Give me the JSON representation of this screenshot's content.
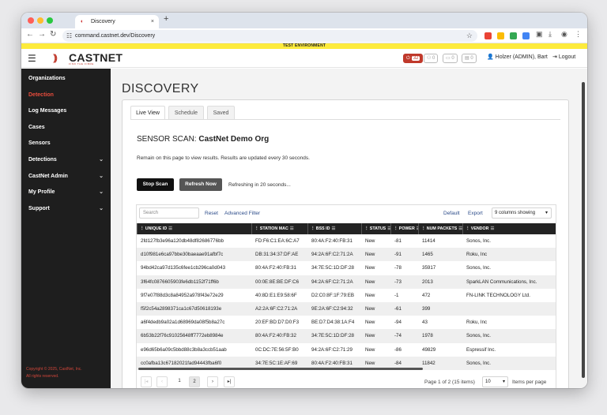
{
  "browser": {
    "tab_title": "Discovery",
    "tab_close": "×",
    "new_tab": "+",
    "url": "command.castnet.dev/Discovery",
    "lights": [
      "#ff5f57",
      "#febc2e",
      "#28c840"
    ],
    "ext_colors": [
      "#ea4335",
      "#fbbc05",
      "#34a853",
      "#4285f4"
    ]
  },
  "banner": "TEST ENVIRONMENT",
  "header": {
    "logo_text": "CASTNET",
    "logo_tagline": "FIND THE FIBRE",
    "alert_count": "32",
    "badges": [
      "0",
      "0",
      "0",
      "0"
    ],
    "user": "Holzer (ADMIN), Bart",
    "logout": "Logout",
    "accent": "#c0392b"
  },
  "sidebar": {
    "items": [
      {
        "label": "Organizations",
        "chev": ""
      },
      {
        "label": "Detection",
        "chev": ""
      },
      {
        "label": "Log Messages",
        "chev": ""
      },
      {
        "label": "Cases",
        "chev": ""
      },
      {
        "label": "Sensors",
        "chev": ""
      },
      {
        "label": "Detections",
        "chev": "⌄"
      },
      {
        "label": "CastNet Admin",
        "chev": "⌄"
      },
      {
        "label": "My Profile",
        "chev": "⌄"
      },
      {
        "label": "Support",
        "chev": "⌄"
      }
    ],
    "footer_line1": "Copyright © 2025, CastNet, Inc.",
    "footer_line2": "All rights reserved."
  },
  "page": {
    "title": "DISCOVERY",
    "tabs": [
      "Live View",
      "Schedule",
      "Saved"
    ],
    "scan_prefix": "SENSOR SCAN: ",
    "scan_org": "CastNet Demo Org",
    "note": "Remain on this page to view results. Results are updated every 30 seconds.",
    "stop_scan": "Stop Scan",
    "refresh_now": "Refresh Now",
    "refresh_status": "Refreshing in 20 seconds..."
  },
  "grid": {
    "search_placeholder": "Search",
    "reset": "Reset",
    "advanced_filter": "Advanced Filter",
    "default": "Default",
    "export": "Export",
    "columns_showing": "9 columns showing",
    "headers": [
      "UNIQUE ID",
      "STATION MAC",
      "BSS ID",
      "STATUS",
      "POWER",
      "NUM PACKETS",
      "VENDOR"
    ],
    "rows": [
      [
        "2fd127fb3e96a120db48df82686776bb",
        "FD:F6:C1:EA:6C:A7",
        "80:4A:F2:40:FB:31",
        "New",
        "-81",
        "11414",
        "Sonos, Inc."
      ],
      [
        "d10f981e6ca97bbe30baeaae91afbf7c",
        "DB:31:34:37:DF:AE",
        "94:2A:6F:C2:71:2A",
        "New",
        "-91",
        "1465",
        "Roku, Inc"
      ],
      [
        "94bd42ca97d135c6fee1cb296ca0d043",
        "80:4A:F2:40:FB:31",
        "34:7E:5C:1D:DF:28",
        "New",
        "-78",
        "35917",
        "Sonos, Inc."
      ],
      [
        "3f64fc0876605903fe6db1152f71ff6b",
        "00:0E:8E:BE:DF:C6",
        "94:2A:6F:C2:71:2A",
        "New",
        "-73",
        "2013",
        "SparkLAN Communications, Inc."
      ],
      [
        "9f7e07f88d3c8a84952a978f43e72e29",
        "40:8D:E1:E9:58:6F",
        "D2:C0:8F:1F:79:EB",
        "New",
        "-1",
        "472",
        "FN-LINK TECHNOLOGY Ltd."
      ],
      [
        "f5f2c54a2898371ca1c67d50618193e",
        "A2:2A:6F:C2:71:2A",
        "9E:2A:6F:C2:94:32",
        "New",
        "-61",
        "399",
        ""
      ],
      [
        "a6f4dedb9a02a1d68969da08f5b8a27c",
        "20:EF:BD:D7:D0:F3",
        "BE:D7:D4:38:1A:F4",
        "New",
        "-94",
        "43",
        "Roku, Inc"
      ],
      [
        "6b53b22f76c91025648ff7772eb8984e",
        "80:4A:F2:40:FB:32",
        "34:7E:5C:1D:DF:28",
        "New",
        "-74",
        "1978",
        "Sonos, Inc."
      ],
      [
        "e96d65b6a09c5bbd88c3b8a3ccb51aab",
        "0C:DC:7E:56:5F:B0",
        "94:2A:6F:C2:71:29",
        "New",
        "-86",
        "49829",
        "Espressif Inc."
      ],
      [
        "cc0afba13c67182021fad94443fba6f0",
        "34:7E:5C:1E:AF:69",
        "80:4A:F2:40:FB:31",
        "New",
        "-84",
        "11842",
        "Sonos, Inc."
      ]
    ],
    "pages": [
      "1",
      "2"
    ],
    "page_info": "Page 1 of 2 (15 items)",
    "page_size": "10",
    "items_per_page": "Items per page"
  }
}
